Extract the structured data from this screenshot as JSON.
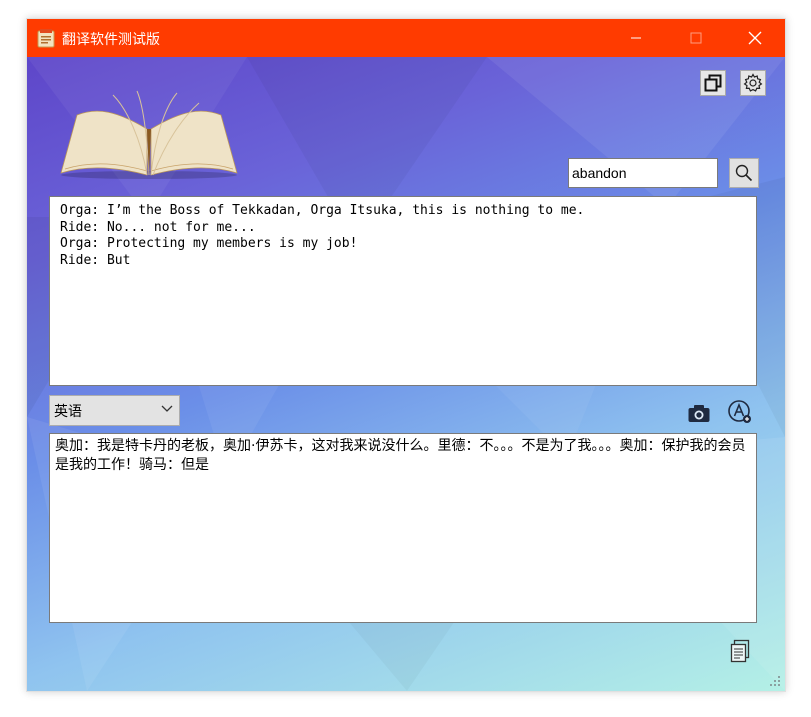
{
  "window": {
    "title": "翻译软件测试版",
    "accent": "#ff3b00",
    "controls": [
      "minimize-icon",
      "maximize-icon",
      "close-icon"
    ]
  },
  "toolbar": {
    "icons": [
      "restore-icon",
      "gear-icon"
    ]
  },
  "search": {
    "value": "abandon",
    "button_icon": "search-icon"
  },
  "source": {
    "lines": [
      "Orga: I’m the Boss of Tekkadan, Orga Itsuka, this is nothing to me.",
      "Ride: No... not for me...",
      "Orga: Protecting my members is my job!",
      "Ride: But"
    ]
  },
  "language": {
    "selected": "英语"
  },
  "actions": {
    "icons": [
      "camera-icon",
      "ocr-icon",
      "copy-icon"
    ]
  },
  "result": {
    "text": "奥加：我是特卡丹的老板，奥加·伊苏卡，这对我来说没什么。里德：不。。。不是为了我。。。奥加：保护我的会员是我的工作！骑马：但是"
  }
}
